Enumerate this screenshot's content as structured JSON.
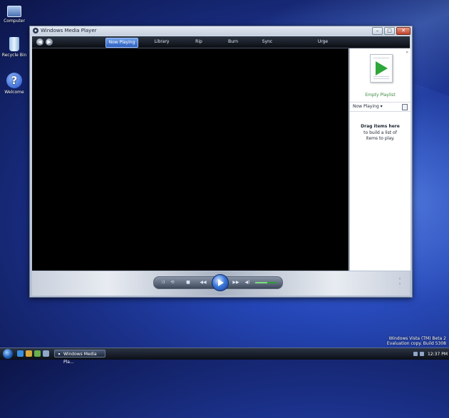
{
  "desktop": {
    "icons": [
      {
        "label": "Computer",
        "icon": "computer-icon"
      },
      {
        "label": "Recycle Bin",
        "icon": "recycle-bin-icon"
      },
      {
        "label": "Welcome",
        "icon": "help-icon"
      }
    ],
    "watermark": {
      "line1": "Windows Vista (TM) Beta 2",
      "line2": "Evaluation copy. Build 5308"
    }
  },
  "window": {
    "title": "Windows Media Player",
    "controls": {
      "minimize": "–",
      "maximize": "□",
      "close": "✕"
    }
  },
  "nav": {
    "back": "◀",
    "forward": "▶",
    "tabs": [
      {
        "label": "Now Playing",
        "active": true
      },
      {
        "label": "Library",
        "active": false
      },
      {
        "label": "Rip",
        "active": false
      },
      {
        "label": "Burn",
        "active": false
      },
      {
        "label": "Sync",
        "active": false
      },
      {
        "label": "Urge",
        "active": false
      }
    ]
  },
  "panel": {
    "dropdown_arrow": "»",
    "empty_playlist": "Empty Playlist",
    "now_playing": "Now Playing ▾",
    "drag_title": "Drag items here",
    "drag_desc": "to build a list of items to play."
  },
  "playback": {
    "shuffle": "⤨",
    "repeat": "⟲",
    "stop": "■",
    "previous": "◀◀",
    "next": "▶▶",
    "mute": "◀)",
    "volume_level": 0.55
  },
  "taskbar": {
    "task_label": "Windows Media Pla...",
    "clock": "12:37 PM"
  },
  "colors": {
    "accent": "#2d5fbf",
    "playlist_green": "#2da63a",
    "video_bg": "#000000"
  }
}
